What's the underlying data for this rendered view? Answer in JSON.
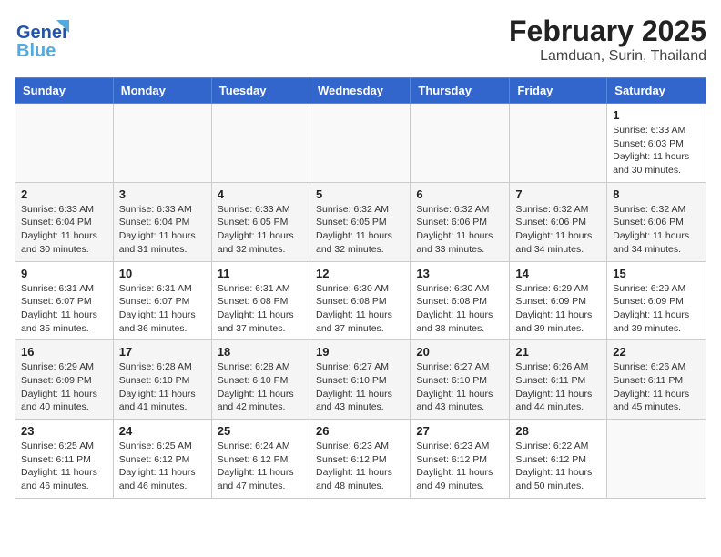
{
  "header": {
    "logo_line1": "General",
    "logo_line2": "Blue",
    "month": "February 2025",
    "location": "Lamduan, Surin, Thailand"
  },
  "weekdays": [
    "Sunday",
    "Monday",
    "Tuesday",
    "Wednesday",
    "Thursday",
    "Friday",
    "Saturday"
  ],
  "weeks": [
    [
      {
        "day": "",
        "info": ""
      },
      {
        "day": "",
        "info": ""
      },
      {
        "day": "",
        "info": ""
      },
      {
        "day": "",
        "info": ""
      },
      {
        "day": "",
        "info": ""
      },
      {
        "day": "",
        "info": ""
      },
      {
        "day": "1",
        "info": "Sunrise: 6:33 AM\nSunset: 6:03 PM\nDaylight: 11 hours\nand 30 minutes."
      }
    ],
    [
      {
        "day": "2",
        "info": "Sunrise: 6:33 AM\nSunset: 6:04 PM\nDaylight: 11 hours\nand 30 minutes."
      },
      {
        "day": "3",
        "info": "Sunrise: 6:33 AM\nSunset: 6:04 PM\nDaylight: 11 hours\nand 31 minutes."
      },
      {
        "day": "4",
        "info": "Sunrise: 6:33 AM\nSunset: 6:05 PM\nDaylight: 11 hours\nand 32 minutes."
      },
      {
        "day": "5",
        "info": "Sunrise: 6:32 AM\nSunset: 6:05 PM\nDaylight: 11 hours\nand 32 minutes."
      },
      {
        "day": "6",
        "info": "Sunrise: 6:32 AM\nSunset: 6:06 PM\nDaylight: 11 hours\nand 33 minutes."
      },
      {
        "day": "7",
        "info": "Sunrise: 6:32 AM\nSunset: 6:06 PM\nDaylight: 11 hours\nand 34 minutes."
      },
      {
        "day": "8",
        "info": "Sunrise: 6:32 AM\nSunset: 6:06 PM\nDaylight: 11 hours\nand 34 minutes."
      }
    ],
    [
      {
        "day": "9",
        "info": "Sunrise: 6:31 AM\nSunset: 6:07 PM\nDaylight: 11 hours\nand 35 minutes."
      },
      {
        "day": "10",
        "info": "Sunrise: 6:31 AM\nSunset: 6:07 PM\nDaylight: 11 hours\nand 36 minutes."
      },
      {
        "day": "11",
        "info": "Sunrise: 6:31 AM\nSunset: 6:08 PM\nDaylight: 11 hours\nand 37 minutes."
      },
      {
        "day": "12",
        "info": "Sunrise: 6:30 AM\nSunset: 6:08 PM\nDaylight: 11 hours\nand 37 minutes."
      },
      {
        "day": "13",
        "info": "Sunrise: 6:30 AM\nSunset: 6:08 PM\nDaylight: 11 hours\nand 38 minutes."
      },
      {
        "day": "14",
        "info": "Sunrise: 6:29 AM\nSunset: 6:09 PM\nDaylight: 11 hours\nand 39 minutes."
      },
      {
        "day": "15",
        "info": "Sunrise: 6:29 AM\nSunset: 6:09 PM\nDaylight: 11 hours\nand 39 minutes."
      }
    ],
    [
      {
        "day": "16",
        "info": "Sunrise: 6:29 AM\nSunset: 6:09 PM\nDaylight: 11 hours\nand 40 minutes."
      },
      {
        "day": "17",
        "info": "Sunrise: 6:28 AM\nSunset: 6:10 PM\nDaylight: 11 hours\nand 41 minutes."
      },
      {
        "day": "18",
        "info": "Sunrise: 6:28 AM\nSunset: 6:10 PM\nDaylight: 11 hours\nand 42 minutes."
      },
      {
        "day": "19",
        "info": "Sunrise: 6:27 AM\nSunset: 6:10 PM\nDaylight: 11 hours\nand 43 minutes."
      },
      {
        "day": "20",
        "info": "Sunrise: 6:27 AM\nSunset: 6:10 PM\nDaylight: 11 hours\nand 43 minutes."
      },
      {
        "day": "21",
        "info": "Sunrise: 6:26 AM\nSunset: 6:11 PM\nDaylight: 11 hours\nand 44 minutes."
      },
      {
        "day": "22",
        "info": "Sunrise: 6:26 AM\nSunset: 6:11 PM\nDaylight: 11 hours\nand 45 minutes."
      }
    ],
    [
      {
        "day": "23",
        "info": "Sunrise: 6:25 AM\nSunset: 6:11 PM\nDaylight: 11 hours\nand 46 minutes."
      },
      {
        "day": "24",
        "info": "Sunrise: 6:25 AM\nSunset: 6:12 PM\nDaylight: 11 hours\nand 46 minutes."
      },
      {
        "day": "25",
        "info": "Sunrise: 6:24 AM\nSunset: 6:12 PM\nDaylight: 11 hours\nand 47 minutes."
      },
      {
        "day": "26",
        "info": "Sunrise: 6:23 AM\nSunset: 6:12 PM\nDaylight: 11 hours\nand 48 minutes."
      },
      {
        "day": "27",
        "info": "Sunrise: 6:23 AM\nSunset: 6:12 PM\nDaylight: 11 hours\nand 49 minutes."
      },
      {
        "day": "28",
        "info": "Sunrise: 6:22 AM\nSunset: 6:12 PM\nDaylight: 11 hours\nand 50 minutes."
      },
      {
        "day": "",
        "info": ""
      }
    ]
  ]
}
